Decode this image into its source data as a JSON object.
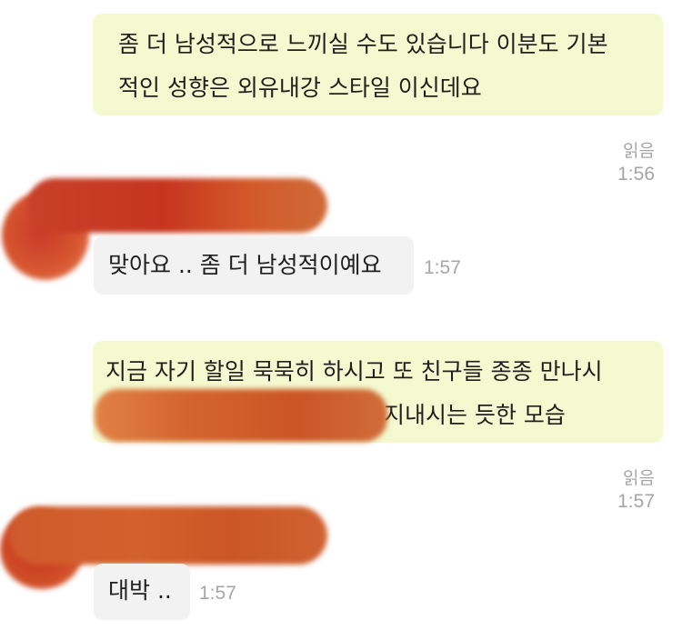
{
  "messages": [
    {
      "lines": [
        "좀 더 남성적으로 느끼실 수도 있습니다 이분도 기본",
        "적인 성향은 외유내강 스타일 이신데요"
      ],
      "read": "읽음",
      "time": "1:56"
    },
    {
      "text": "맞아요 .. 좀 더 남성적이예요",
      "time": "1:57"
    },
    {
      "lines": [
        "지금 자기 할일 묵묵히 하시고 또 친구들 종종 만나시",
        "지내시는 듯한 모습"
      ],
      "read": "읽음",
      "time": "1:57"
    },
    {
      "text": "대박 ..",
      "time": "1:57"
    }
  ],
  "colors": {
    "my_bubble": "#f4f9cf",
    "their_bubble": "#f2f2f2",
    "meta_text": "#a6a6a6",
    "redaction": "#cc4a1e"
  }
}
